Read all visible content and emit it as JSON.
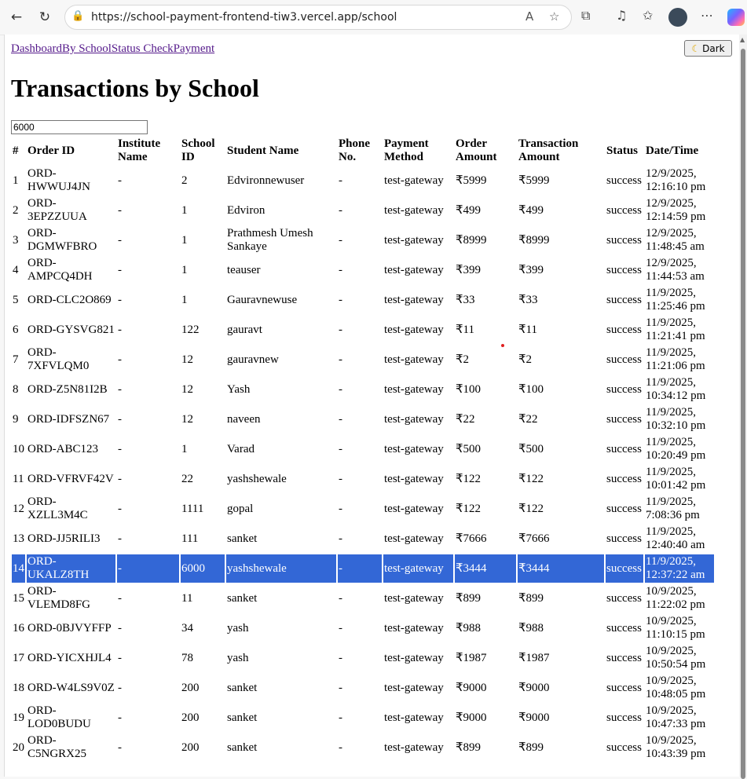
{
  "browser": {
    "url": "https://school-payment-frontend-tiw3.vercel.app/school"
  },
  "nav": {
    "links": [
      "Dashboard",
      "By School",
      "Status Check",
      "Payment"
    ],
    "dark_label": "Dark"
  },
  "page": {
    "title": "Transactions by School",
    "filter_value": "6000"
  },
  "table": {
    "headers": [
      "#",
      "Order ID",
      "Institute Name",
      "School ID",
      "Student Name",
      "Phone No.",
      "Payment Method",
      "Order Amount",
      "Transaction Amount",
      "Status",
      "Date/Time"
    ],
    "rows": [
      [
        "1",
        "ORD-HWWUJ4JN",
        "-",
        "2",
        "Edvironnewuser",
        "-",
        "test-gateway",
        "₹5999",
        "₹5999",
        "success",
        "12/9/2025, 12:16:10 pm"
      ],
      [
        "2",
        "ORD-3EPZZUUA",
        "-",
        "1",
        "Edviron",
        "-",
        "test-gateway",
        "₹499",
        "₹499",
        "success",
        "12/9/2025, 12:14:59 pm"
      ],
      [
        "3",
        "ORD-DGMWFBRO",
        "-",
        "1",
        "Prathmesh Umesh Sankaye",
        "-",
        "test-gateway",
        "₹8999",
        "₹8999",
        "success",
        "12/9/2025, 11:48:45 am"
      ],
      [
        "4",
        "ORD-AMPCQ4DH",
        "-",
        "1",
        "teauser",
        "-",
        "test-gateway",
        "₹399",
        "₹399",
        "success",
        "12/9/2025, 11:44:53 am"
      ],
      [
        "5",
        "ORD-CLC2O869",
        "-",
        "1",
        "Gauravnewuse",
        "-",
        "test-gateway",
        "₹33",
        "₹33",
        "success",
        "11/9/2025, 11:25:46 pm"
      ],
      [
        "6",
        "ORD-GYSVG821",
        "-",
        "122",
        "gauravt",
        "-",
        "test-gateway",
        "₹11",
        "₹11",
        "success",
        "11/9/2025, 11:21:41 pm"
      ],
      [
        "7",
        "ORD-7XFVLQM0",
        "-",
        "12",
        "gauravnew",
        "-",
        "test-gateway",
        "₹2",
        "₹2",
        "success",
        "11/9/2025, 11:21:06 pm"
      ],
      [
        "8",
        "ORD-Z5N81I2B",
        "-",
        "12",
        "Yash",
        "-",
        "test-gateway",
        "₹100",
        "₹100",
        "success",
        "11/9/2025, 10:34:12 pm"
      ],
      [
        "9",
        "ORD-IDFSZN67",
        "-",
        "12",
        "naveen",
        "-",
        "test-gateway",
        "₹22",
        "₹22",
        "success",
        "11/9/2025, 10:32:10 pm"
      ],
      [
        "10",
        "ORD-ABC123",
        "-",
        "1",
        "Varad",
        "-",
        "test-gateway",
        "₹500",
        "₹500",
        "success",
        "11/9/2025, 10:20:49 pm"
      ],
      [
        "11",
        "ORD-VFRVF42V",
        "-",
        "22",
        "yashshewale",
        "-",
        "test-gateway",
        "₹122",
        "₹122",
        "success",
        "11/9/2025, 10:01:42 pm"
      ],
      [
        "12",
        "ORD-XZLL3M4C",
        "-",
        "1111",
        "gopal",
        "-",
        "test-gateway",
        "₹122",
        "₹122",
        "success",
        "11/9/2025, 7:08:36 pm"
      ],
      [
        "13",
        "ORD-JJ5RILI3",
        "-",
        "111",
        "sanket",
        "-",
        "test-gateway",
        "₹7666",
        "₹7666",
        "success",
        "11/9/2025, 12:40:40 am"
      ],
      [
        "14",
        "ORD-UKALZ8TH",
        "-",
        "6000",
        "yashshewale",
        "-",
        "test-gateway",
        "₹3444",
        "₹3444",
        "success",
        "11/9/2025, 12:37:22 am"
      ],
      [
        "15",
        "ORD-VLEMD8FG",
        "-",
        "11",
        "sanket",
        "-",
        "test-gateway",
        "₹899",
        "₹899",
        "success",
        "10/9/2025, 11:22:02 pm"
      ],
      [
        "16",
        "ORD-0BJVYFFP",
        "-",
        "34",
        "yash",
        "-",
        "test-gateway",
        "₹988",
        "₹988",
        "success",
        "10/9/2025, 11:10:15 pm"
      ],
      [
        "17",
        "ORD-YICXHJL4",
        "-",
        "78",
        "yash",
        "-",
        "test-gateway",
        "₹1987",
        "₹1987",
        "success",
        "10/9/2025, 10:50:54 pm"
      ],
      [
        "18",
        "ORD-W4LS9V0Z",
        "-",
        "200",
        "sanket",
        "-",
        "test-gateway",
        "₹9000",
        "₹9000",
        "success",
        "10/9/2025, 10:48:05 pm"
      ],
      [
        "19",
        "ORD-LOD0BUDU",
        "-",
        "200",
        "sanket",
        "-",
        "test-gateway",
        "₹9000",
        "₹9000",
        "success",
        "10/9/2025, 10:47:33 pm"
      ],
      [
        "20",
        "ORD-C5NGRX25",
        "-",
        "200",
        "sanket",
        "-",
        "test-gateway",
        "₹899",
        "₹899",
        "success",
        "10/9/2025, 10:43:39 pm"
      ]
    ],
    "selected_row": 13,
    "selection_color": "#3367d6"
  }
}
